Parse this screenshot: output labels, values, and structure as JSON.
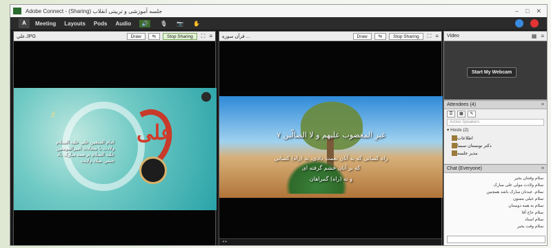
{
  "window": {
    "title": "جلسه آموزشی و تربیتی انقلاب (Sharing) - Adobe Connect",
    "controls": [
      "–",
      "□",
      "✕"
    ]
  },
  "menubar": {
    "items": [
      "Meeting",
      "Layouts",
      "Pods",
      "Audio"
    ],
    "tools": [
      {
        "icon": "speaker-icon",
        "glyph": "🔊",
        "active": true
      },
      {
        "icon": "microphone-icon",
        "glyph": "🎙",
        "active": false
      },
      {
        "icon": "webcam-icon",
        "glyph": "📷",
        "active": false
      },
      {
        "icon": "raise-hand-icon",
        "glyph": "✋",
        "active": false
      }
    ]
  },
  "pods": {
    "left": {
      "title": "علي.JPG",
      "draw_label": "Draw",
      "stop_label": "Stop Sharing"
    },
    "middle": {
      "title": "قرآن سوره ...",
      "draw_label": "Draw",
      "stop_label": "Stop Sharing"
    },
    "video": {
      "title": "Video",
      "webcam_label": "Start My Webcam"
    }
  },
  "slide_left": {
    "big_text": "علی",
    "gold_text": "ع",
    "lines": [
      "امام المتقين علي عليه السلام",
      "ولادت با سعادت امیرالمومنین",
      "علیه السلام بر همه مبارک باد",
      "جشن میلاد ولایت"
    ]
  },
  "slide_mid": {
    "line1": "غیرِ المغضوب علیهم و لا الضالّین ۷",
    "line2": "راه کسانی که به آنان نعمت دادی، نه (راه) کسانی",
    "line3": "که بر آنان خشم گرفته ای",
    "line4": "و نه (راه) گمراهان"
  },
  "attendees": {
    "title": "Attendees (4)",
    "search_placeholder": "Active Speakers",
    "host_label": "▾ Hosts (2)",
    "list": [
      "اطلاعات",
      "دکتر نوبستان سیما",
      "مدیر جلسه"
    ]
  },
  "chat": {
    "title": "Chat (Everyone)",
    "messages": [
      "سلام وقتتان بخیر",
      "سلام ولادت مولی علی مبارک",
      "سلام. عیدتان مبارک باشد همچنین",
      "سلام خیلی ممنون",
      "سلام به همه دوستان",
      "سلام حاج آقا",
      "سلام استاد",
      "سلام وقت بخیر"
    ]
  }
}
